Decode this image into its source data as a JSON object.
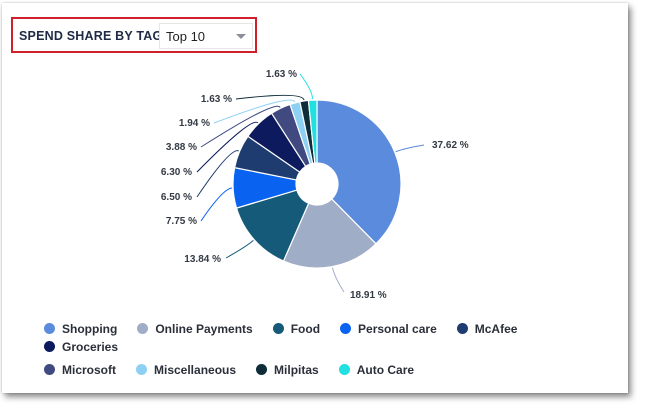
{
  "header": {
    "title": "SPEND SHARE BY TAGS",
    "filter_value": "Top 10"
  },
  "chart_data": {
    "type": "pie",
    "donut": true,
    "title": "SPEND SHARE BY TAGS",
    "legend_position": "bottom",
    "categories": [
      "Shopping",
      "Online Payments",
      "Food",
      "Personal care",
      "McAfee",
      "Groceries",
      "Microsoft",
      "Miscellaneous",
      "Milpitas",
      "Auto Care"
    ],
    "values": [
      37.62,
      18.91,
      13.84,
      7.75,
      6.5,
      6.3,
      3.88,
      1.94,
      1.63,
      1.63
    ],
    "labels": [
      "37.62 %",
      "18.91 %",
      "13.84 %",
      "7.75 %",
      "6.50 %",
      "6.30 %",
      "3.88 %",
      "1.94 %",
      "1.63 %",
      "1.63 %"
    ],
    "colors": [
      "#5b8bdc",
      "#a0adc6",
      "#155a78",
      "#0a63f0",
      "#1f3c70",
      "#0e1a5e",
      "#414a80",
      "#8dd0f4",
      "#0e2c3a",
      "#20e0e0"
    ]
  }
}
